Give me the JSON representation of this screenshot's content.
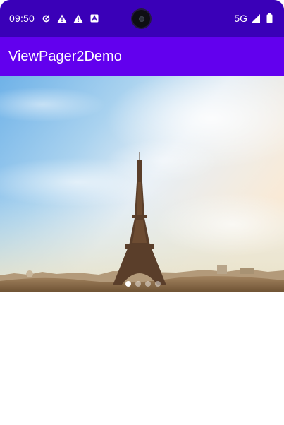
{
  "status_bar": {
    "time": "09:50",
    "network": "5G",
    "icons": [
      "sync-icon",
      "warning-icon",
      "warning-icon",
      "accessibility-icon",
      "signal-icon",
      "battery-icon"
    ]
  },
  "app_bar": {
    "title": "ViewPager2Demo",
    "color": "#6200ee"
  },
  "pager": {
    "image": "eiffel-tower-photo",
    "page_count": 4,
    "current_page": 1
  },
  "colors": {
    "status_bar": "#3a00b8",
    "app_bar": "#6200ee"
  }
}
